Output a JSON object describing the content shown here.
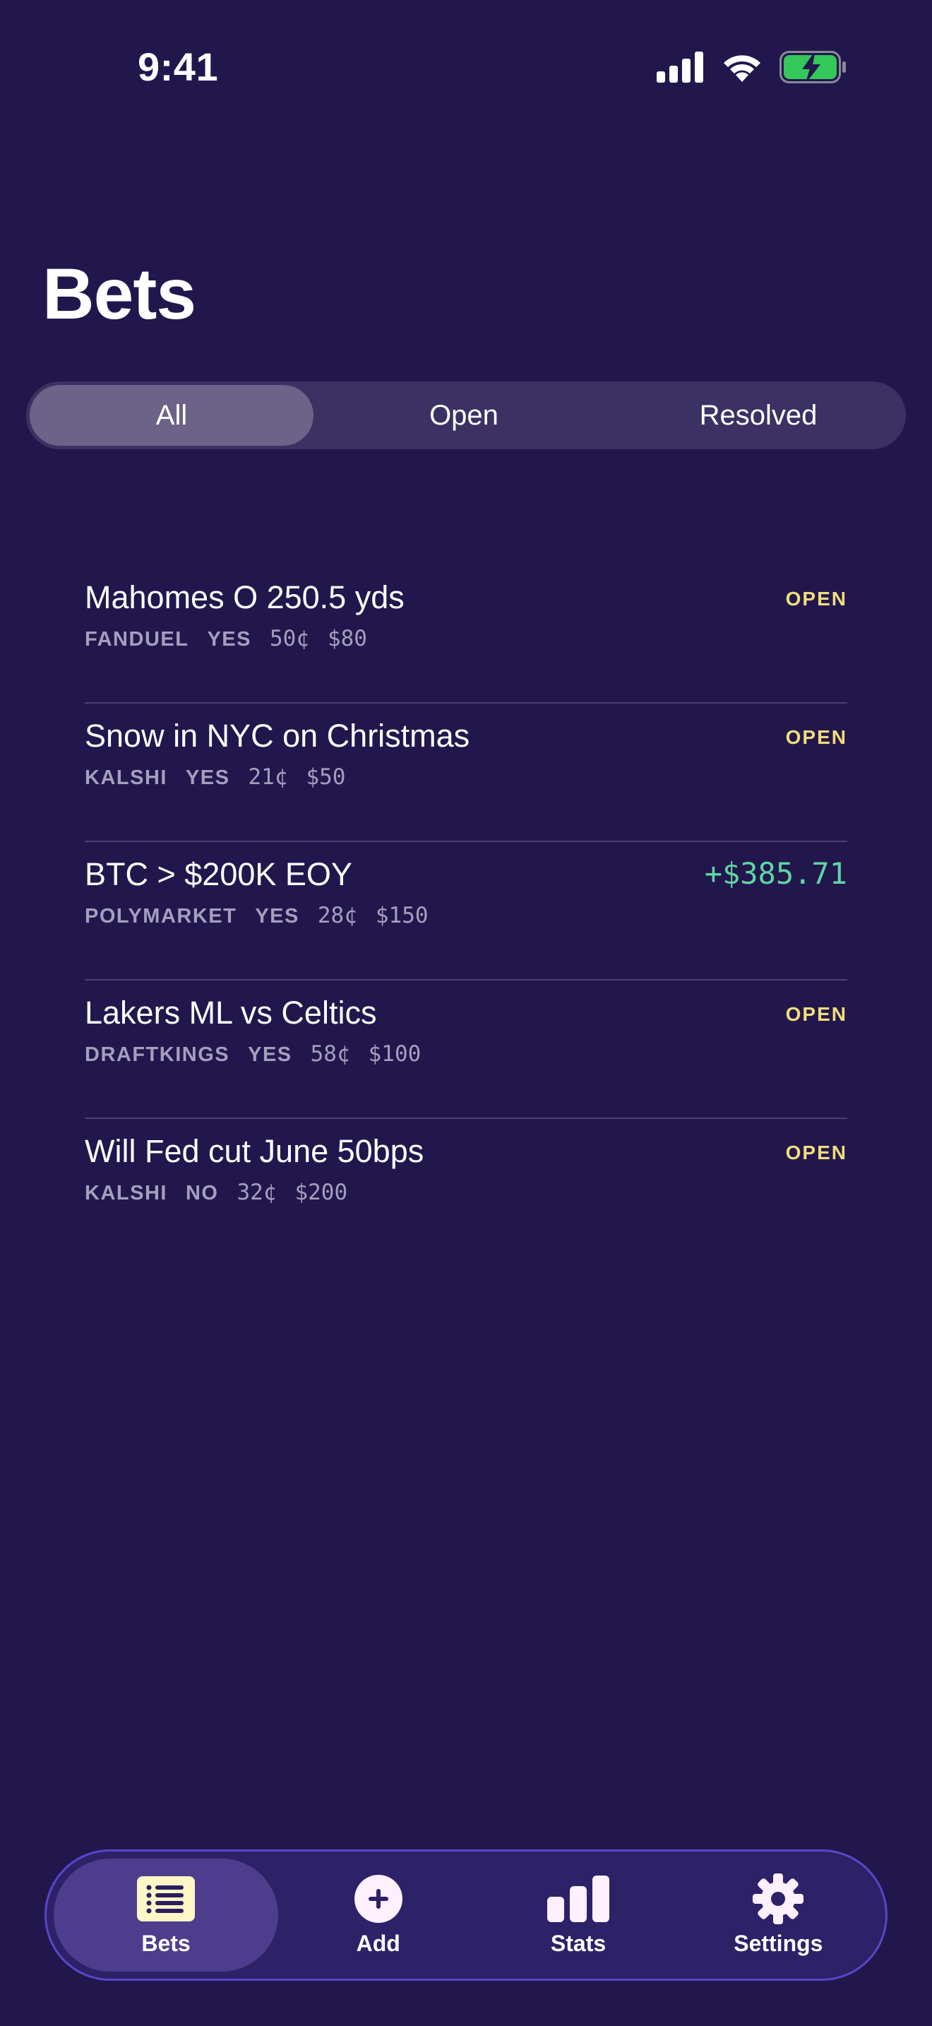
{
  "status_bar": {
    "time": "9:41"
  },
  "page": {
    "title": "Bets"
  },
  "segments": [
    {
      "label": "All",
      "active": true
    },
    {
      "label": "Open",
      "active": false
    },
    {
      "label": "Resolved",
      "active": false
    }
  ],
  "bets": [
    {
      "title": "Mahomes O 250.5 yds",
      "book": "FANDUEL",
      "side": "YES",
      "price": "50¢",
      "stake": "$80",
      "status": "OPEN"
    },
    {
      "title": "Snow in NYC on Christmas",
      "book": "KALSHI",
      "side": "YES",
      "price": "21¢",
      "stake": "$50",
      "status": "OPEN"
    },
    {
      "title": "BTC > $200K EOY",
      "book": "POLYMARKET",
      "side": "YES",
      "price": "28¢",
      "stake": "$150",
      "pnl": "+$385.71"
    },
    {
      "title": "Lakers ML vs Celtics",
      "book": "DRAFTKINGS",
      "side": "YES",
      "price": "58¢",
      "stake": "$100",
      "status": "OPEN"
    },
    {
      "title": "Will Fed cut June 50bps",
      "book": "KALSHI",
      "side": "NO",
      "price": "32¢",
      "stake": "$200",
      "status": "OPEN"
    }
  ],
  "tabs": [
    {
      "label": "Bets",
      "icon": "list-icon",
      "active": true
    },
    {
      "label": "Add",
      "icon": "plus-circle-icon",
      "active": false
    },
    {
      "label": "Stats",
      "icon": "bar-chart-icon",
      "active": false
    },
    {
      "label": "Settings",
      "icon": "gear-icon",
      "active": false
    }
  ],
  "colors": {
    "background": "#22174d",
    "open_status": "#f1dd7b",
    "positive_pnl": "#5fd5a3",
    "battery": "#34c759",
    "tab_accent": "#5b45c8"
  }
}
